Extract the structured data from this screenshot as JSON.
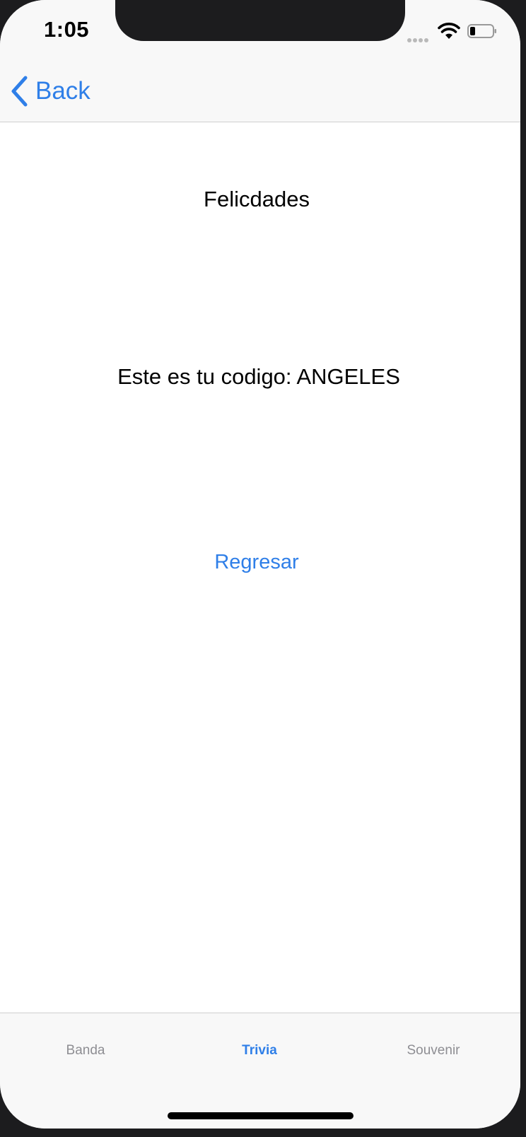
{
  "status_bar": {
    "time": "1:05",
    "signal_icon": "cellular-signal-icon",
    "wifi_icon": "wifi-icon",
    "battery_icon": "battery-icon"
  },
  "nav": {
    "back_label": "Back",
    "back_icon": "chevron-left-icon"
  },
  "content": {
    "title": "Felicdades",
    "code_line": "Este es tu codigo: ANGELES",
    "return_label": "Regresar"
  },
  "tabs": [
    {
      "label": "Banda",
      "selected": false
    },
    {
      "label": "Trivia",
      "selected": true
    },
    {
      "label": "Souvenir",
      "selected": false
    }
  ],
  "colors": {
    "accent": "#2f7fe8",
    "tab_inactive": "#8e8e93",
    "bar_background": "#f8f8f8",
    "frame": "#1c1c1e"
  }
}
